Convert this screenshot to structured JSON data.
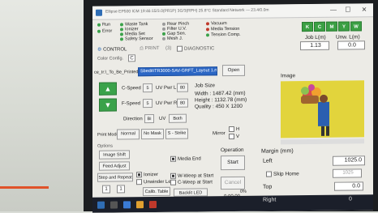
{
  "window": {
    "title": "Ellipse EP500 ICM 19:46:15/3.0(PR1P) 3G/3(RPH) 25.8°C Standard Network — 23.4/0.0m",
    "minimize": "—",
    "maximize": "☐",
    "close": "✕"
  },
  "status_left": [
    {
      "label": "Run",
      "color": "#3aa24a"
    },
    {
      "label": "Error",
      "color": "#3aa24a"
    }
  ],
  "status_mid": [
    {
      "label": "Waste Tank",
      "color": "#3aa24a"
    },
    {
      "label": "Ionizer",
      "color": "#3aa24a"
    },
    {
      "label": "Media Set",
      "color": "#3aa24a"
    },
    {
      "label": "Safety Sensor",
      "color": "#3aa24a"
    }
  ],
  "status_rear": [
    {
      "label": "Rear Pinch",
      "color": "#9a9a9a"
    },
    {
      "label": "Filter U.V.",
      "color": "#9a9a9a"
    },
    {
      "label": "Gap Sen.",
      "color": "#3aa24a"
    },
    {
      "label": "Mesh J.",
      "color": "#9a9a9a"
    }
  ],
  "status_right": [
    {
      "label": "Vacuum",
      "color": "#c0392b"
    },
    {
      "label": "Media Tension",
      "color": "#c0392b"
    },
    {
      "label": "Tension Comp.",
      "color": "#3aa24a"
    }
  ],
  "inks": [
    "K",
    "C",
    "M",
    "Y",
    "W"
  ],
  "job": {
    "job_l_label": "Job L(m)",
    "job_l_value": "1.13",
    "unw_label": "Unw. L(m)",
    "unw_value": "0.0"
  },
  "menu": {
    "control": "CONTROL",
    "print": "PRINT",
    "print_count": "(3)",
    "diagnostic": "DIAGNOSTIC"
  },
  "color_config": {
    "label": "Color Config.",
    "value": "C"
  },
  "file": {
    "prefix": "ce_Ir:\\_To_Be_Printed",
    "path": "Sbedit\\TR3000-SAV-GRFT_Layout 1.rt",
    "open_label": "Open"
  },
  "speed": {
    "c_label": "C-Speed",
    "c_value": "5",
    "uvl_label": "UV Pwr L",
    "uvl_value": "80",
    "f_label": "F-Speed",
    "f_value": "5",
    "uvr_label": "UV Pwr R",
    "uvr_value": "80",
    "dir_label": "Direction",
    "dir_value": "Bi",
    "uv_label": "UV",
    "uv_value": "Both"
  },
  "job_size": {
    "heading": "Job Size",
    "width": "Width : 1487.42 (mm)",
    "height": "Height : 1132.78 (mm)",
    "quality": "Quality : 450 X 1200"
  },
  "print_mode": {
    "label": "Print Mode",
    "normal": "Normal",
    "no_mask": "No Mask",
    "strike": "S - Strike"
  },
  "mirror": {
    "label": "Mirror",
    "h": "H",
    "v": "V"
  },
  "image": {
    "heading": "Image"
  },
  "options": {
    "heading": "Options",
    "image_shift": "Image Shift",
    "feed_adjust": "Feed Adjust",
    "step_repeat": "Step and Repeat",
    "ionizer": "Ionizer",
    "unwinder": "Unwinder Len",
    "media_end": "Media End",
    "w_weep": "W-Weep at Start",
    "c_weep": "C-Weep at Start",
    "repeat_a": "1",
    "repeat_b": "1",
    "calib_table": "Calib. Table",
    "backlit": "Backlit LED"
  },
  "operation": {
    "heading": "Operation",
    "start": "Start",
    "cancel": "Cancel",
    "percent": "0%",
    "time": "0:00:00"
  },
  "margin": {
    "heading": "Margin (mm)",
    "left_label": "Left",
    "left_value": "1025.0",
    "skip_label": "Skip Home",
    "skip_value": "1025",
    "top_label": "Top",
    "top_value": "0.0",
    "right_label": "Right",
    "right_value": "0"
  }
}
